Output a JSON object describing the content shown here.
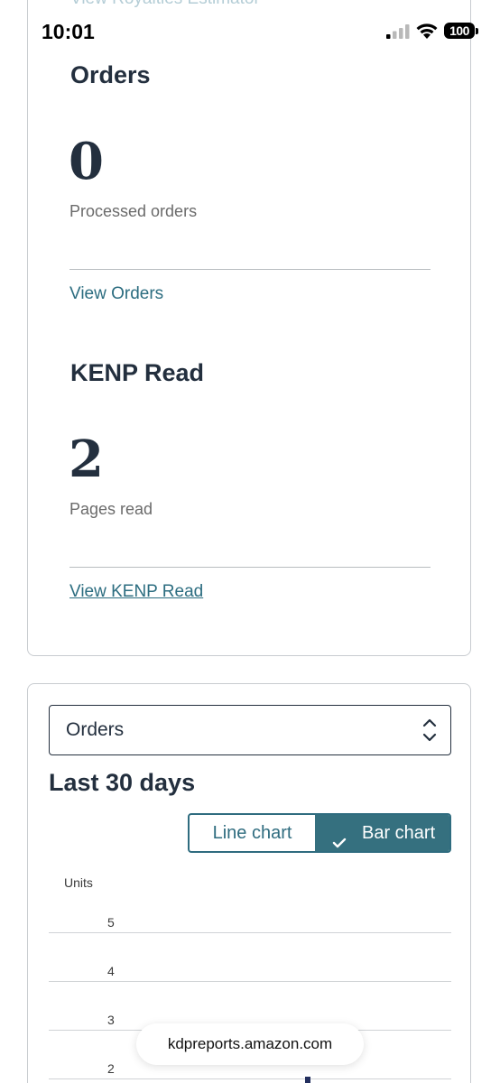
{
  "status_bar": {
    "time": "10:01",
    "battery": "100"
  },
  "scrolled_link": "View Royalties Estimator",
  "orders_summary": {
    "title": "Orders",
    "value": "0",
    "label": "Processed orders",
    "link": "View Orders"
  },
  "kenp_summary": {
    "title": "KENP Read",
    "value": "2",
    "label": "Pages read",
    "link": "View KENP Read"
  },
  "metric_select": {
    "value": "Orders"
  },
  "period_title": "Last 30 days",
  "chart_toggle": {
    "line_label": "Line chart",
    "bar_label": "Bar chart",
    "selected": "Bar chart"
  },
  "chart_data": {
    "type": "bar",
    "ylabel": "Units",
    "y_ticks": [
      "5",
      "4",
      "3",
      "2"
    ],
    "visible_y_range": [
      2,
      5
    ]
  },
  "url_bar": {
    "url": "kdpreports.amazon.com"
  },
  "colors": {
    "link": "#2c6d80",
    "toggle_active": "#35707f",
    "heading": "#232f3e",
    "bar": "#232f5e"
  }
}
